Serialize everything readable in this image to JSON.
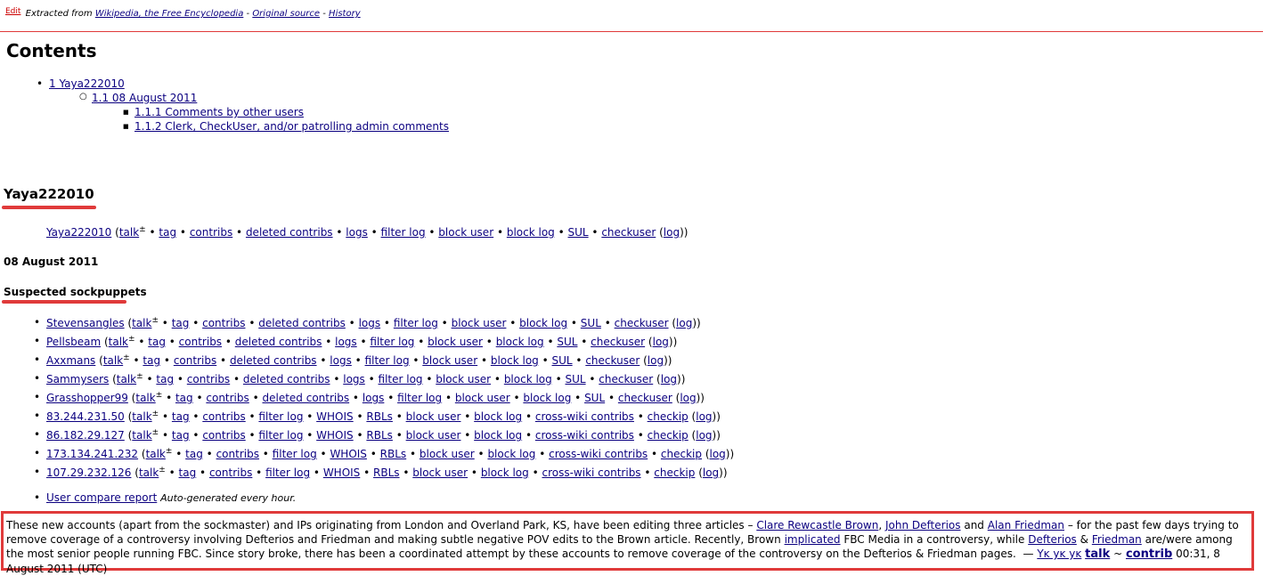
{
  "header": {
    "edit": "Edit",
    "extracted_prefix": "Extracted from",
    "wiki_link": "Wikipedia, the Free Encyclopedia",
    "sep1": "-",
    "original_source": "Original source",
    "sep2": "-",
    "history": "History"
  },
  "contents": {
    "title": "Contents",
    "items": [
      "1 Yaya222010",
      "1.1 08 August 2011",
      "1.1.1 Comments by other users",
      "1.1.2 Clerk, CheckUser, and/or patrolling admin comments"
    ]
  },
  "section_title": "Yaya222010",
  "sockmaster": {
    "name": "Yaya222010",
    "links": [
      "talk",
      "tag",
      "contribs",
      "deleted contribs",
      "logs",
      "filter log",
      "block user",
      "block log",
      "SUL",
      "checkuser",
      "log"
    ]
  },
  "date_heading": "08 August 2011",
  "suspected_heading": "Suspected sockpuppets",
  "user_links": [
    "talk",
    "tag",
    "contribs",
    "deleted contribs",
    "logs",
    "filter log",
    "block user",
    "block log",
    "SUL",
    "checkuser",
    "log"
  ],
  "ip_links": [
    "talk",
    "tag",
    "contribs",
    "filter log",
    "WHOIS",
    "RBLs",
    "block user",
    "block log",
    "cross-wiki contribs",
    "checkip",
    "log"
  ],
  "sockpuppets": [
    {
      "name": "Stevensangles",
      "type": "user"
    },
    {
      "name": "Pellsbeam",
      "type": "user"
    },
    {
      "name": "Axxmans",
      "type": "user"
    },
    {
      "name": "Sammysers",
      "type": "user"
    },
    {
      "name": "Grasshopper99",
      "type": "user"
    },
    {
      "name": "83.244.231.50",
      "type": "ip"
    },
    {
      "name": "86.182.29.127",
      "type": "ip"
    },
    {
      "name": "173.134.241.232",
      "type": "ip"
    },
    {
      "name": "107.29.232.126",
      "type": "ip"
    }
  ],
  "report": {
    "link": "User compare report",
    "note": "Auto-generated every hour."
  },
  "comment": {
    "t1": "These new accounts (apart from the sockmaster) and IPs originating from London and Overland Park, KS, have been editing three articles –",
    "l1": "Clare Rewcastle Brown",
    "t2": ",",
    "l2": "John Defterios",
    "t3": "and",
    "l3": "Alan Friedman",
    "t4": "– for the past few days trying to remove coverage of a controversy involving Defterios and Friedman and making subtle negative POV edits to the Brown article. Recently, Brown",
    "l4": "implicated",
    "t5": "FBC Media in a controversy, while",
    "l5": "Defterios",
    "t6": "&",
    "l6": "Friedman",
    "t7": "are/were among the most senior people running FBC. Since story broke, there has been a coordinated attempt by these accounts to remove coverage of the controversy on the Defterios & Friedman pages.",
    "dash": "—",
    "sig_name": "Yĸ yĸ yĸ",
    "sig_talk": "talk",
    "tilde": "~",
    "sig_contrib": "contrib",
    "timestamp": "00:31, 8 August 2011 (UTC)"
  }
}
